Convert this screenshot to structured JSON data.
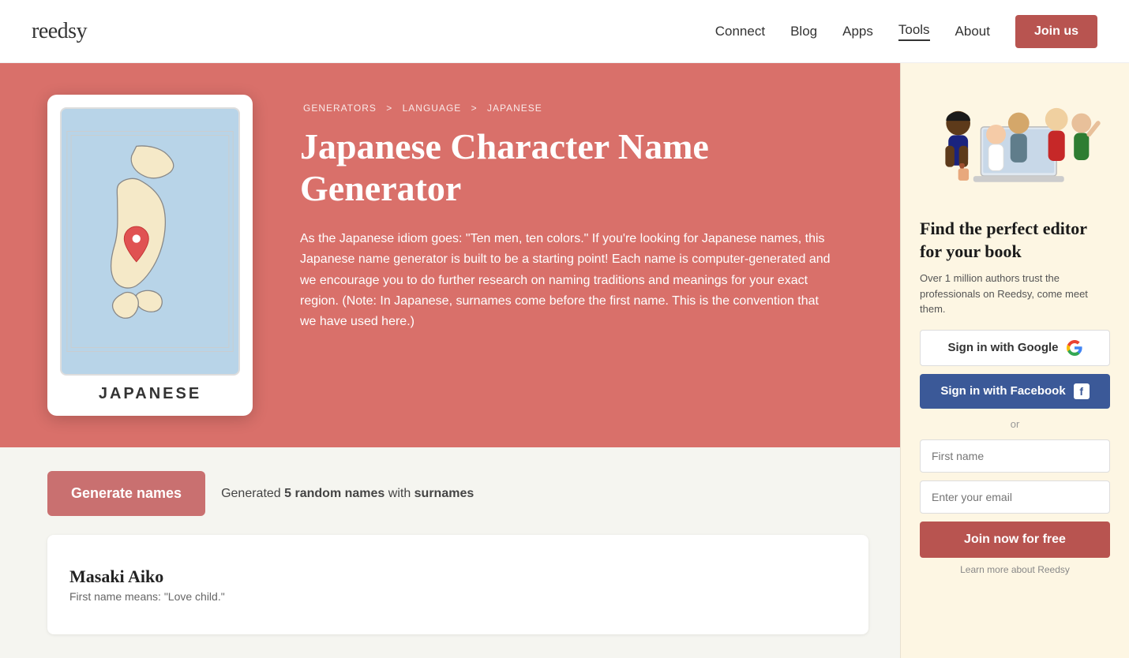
{
  "header": {
    "logo": "reedsy",
    "nav": {
      "links": [
        {
          "label": "Connect",
          "active": false
        },
        {
          "label": "Blog",
          "active": false
        },
        {
          "label": "Apps",
          "active": false
        },
        {
          "label": "Tools",
          "active": true
        },
        {
          "label": "About",
          "active": false
        }
      ],
      "join_label": "Join us"
    }
  },
  "breadcrumb": {
    "items": [
      "GENERATORS",
      ">",
      "LANGUAGE",
      ">",
      "JAPANESE"
    ]
  },
  "hero": {
    "title": "Japanese Character Name Generator",
    "description": "As the Japanese idiom goes: \"Ten men, ten colors.\" If you're looking for Japanese names, this Japanese name generator is built to be a starting point! Each name is computer-generated and we encourage you to do further research on naming traditions and meanings for your exact region. (Note: In Japanese, surnames come before the first name. This is the convention that we have used here.)",
    "card_label": "JAPANESE"
  },
  "generator": {
    "button_label": "Generate names",
    "generated_text_prefix": "Generated",
    "count": "5",
    "count_label": "random names",
    "with_label": "with",
    "type_label": "surnames"
  },
  "names": [
    {
      "name": "Masaki Aiko",
      "meaning": "First name means: \"Love child.\""
    }
  ],
  "sidebar": {
    "title": "Find the perfect editor for your book",
    "description": "Over 1 million authors trust the professionals on Reedsy, come meet them.",
    "google_label": "Sign in with Google",
    "facebook_label": "Sign in with Facebook",
    "or": "or",
    "first_name_placeholder": "First name",
    "email_placeholder": "Enter your email",
    "join_label": "Join now for free",
    "learn_more": "Learn more about Reedsy"
  }
}
